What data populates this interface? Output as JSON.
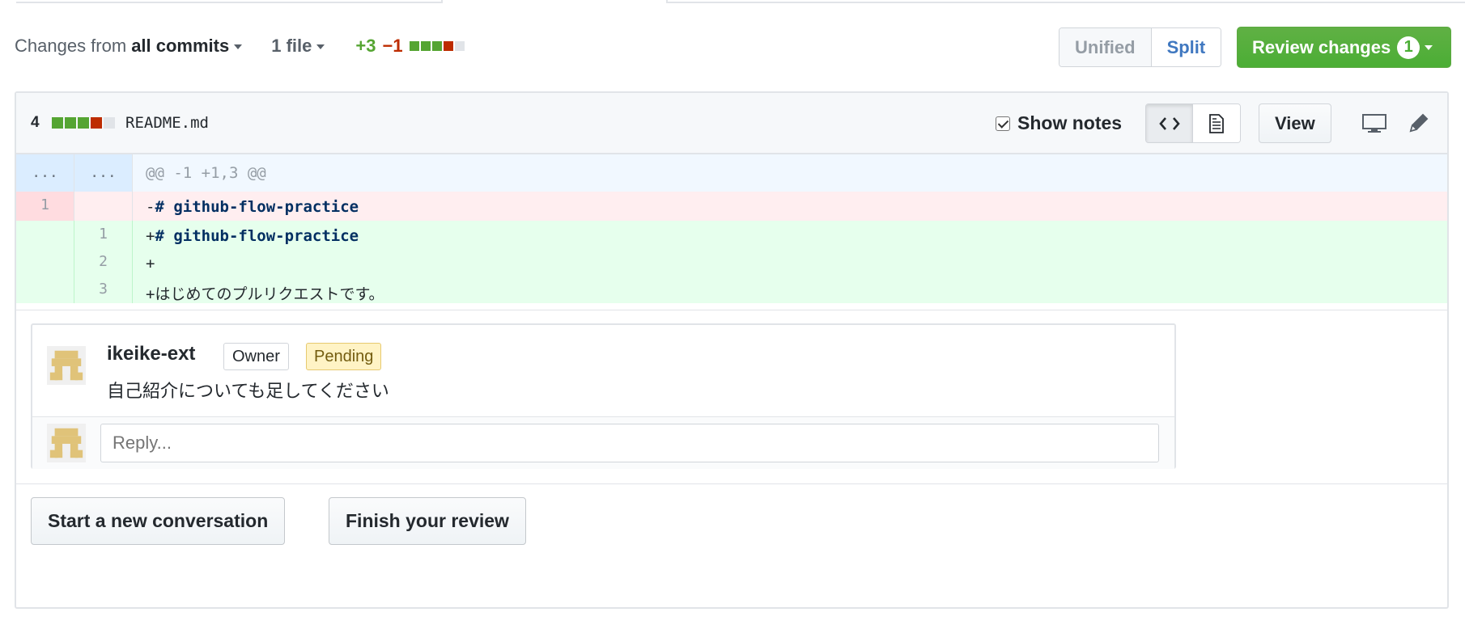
{
  "toolbar": {
    "changes_prefix": "Changes from",
    "commits_selector": "all commits",
    "files_selector": "1 file",
    "additions": "+3",
    "deletions": "−1",
    "stat_blocks": [
      "g",
      "g",
      "g",
      "r",
      "n"
    ],
    "view_unified": "Unified",
    "view_split": "Split",
    "review_button": "Review changes",
    "review_count": "1"
  },
  "file": {
    "change_count": "4",
    "stat_blocks": [
      "g",
      "g",
      "g",
      "r",
      "n"
    ],
    "name": "README.md",
    "show_notes_label": "Show notes",
    "view_button": "View",
    "icons": [
      "code-icon",
      "file-text-icon",
      "desktop-icon",
      "pencil-icon"
    ]
  },
  "diff": {
    "hunk_left": "...",
    "hunk_right": "...",
    "hunk_header": "@@ -1 +1,3 @@",
    "lines": [
      {
        "type": "del",
        "old": "1",
        "new": "",
        "sign": "-",
        "text": "# github-flow-practice"
      },
      {
        "type": "add",
        "old": "",
        "new": "1",
        "sign": "+",
        "text": "# github-flow-practice"
      },
      {
        "type": "add",
        "old": "",
        "new": "2",
        "sign": "+",
        "text": ""
      },
      {
        "type": "add",
        "old": "",
        "new": "3",
        "sign": "+",
        "text": "はじめてのプルリクエストです。"
      }
    ]
  },
  "comment": {
    "author": "ikeike-ext",
    "owner_badge": "Owner",
    "pending_badge": "Pending",
    "body": "自己紹介についても足してください",
    "reply_placeholder": "Reply..."
  },
  "actions": {
    "start_conversation": "Start a new conversation",
    "finish_review": "Finish your review"
  }
}
